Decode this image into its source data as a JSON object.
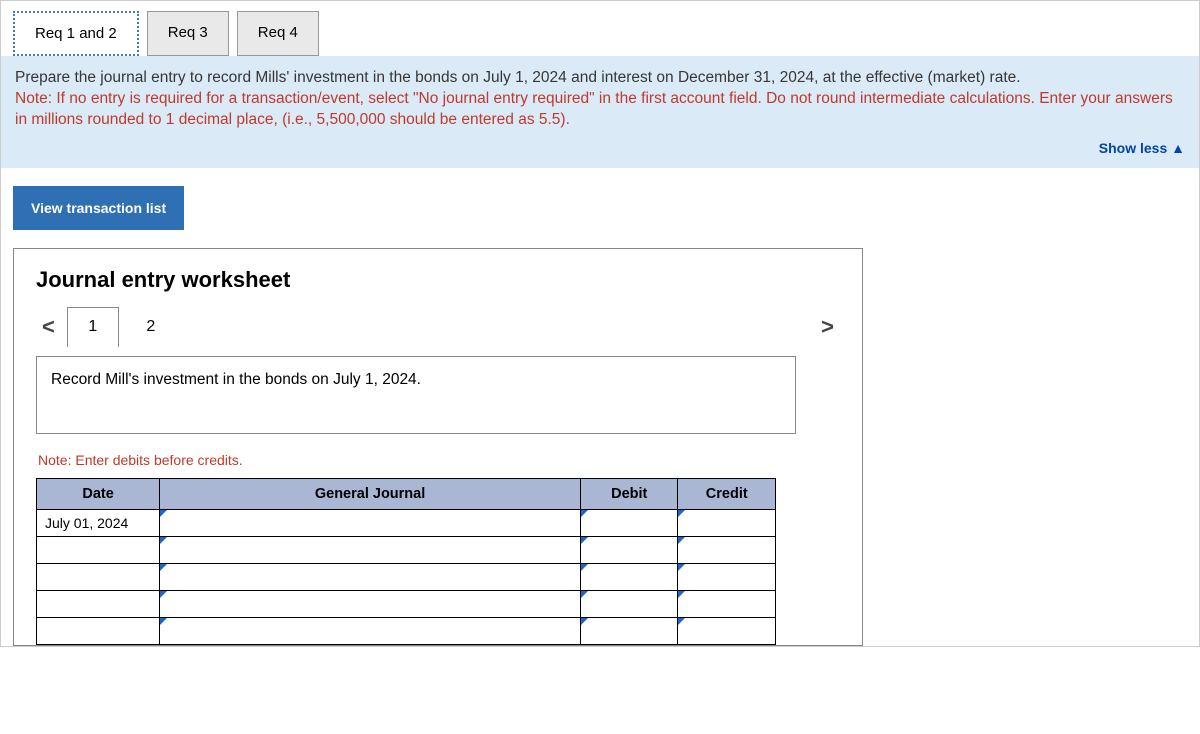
{
  "tabs": {
    "t1": "Req 1 and 2",
    "t2": "Req 3",
    "t3": "Req 4"
  },
  "instructions": {
    "main": "Prepare the journal entry to record Mills' investment in the bonds on July 1, 2024 and interest on December 31, 2024, at the effective (market) rate.",
    "note": "Note: If no entry is required for a transaction/event, select \"No journal entry required\" in the first account field. Do not round intermediate calculations. Enter your answers in millions rounded to 1 decimal place, (i.e., 5,500,000 should be entered as 5.5).",
    "show_less": "Show less"
  },
  "buttons": {
    "view_txn": "View transaction list"
  },
  "worksheet": {
    "title": "Journal entry worksheet",
    "pages": {
      "p1": "1",
      "p2": "2"
    },
    "entry_desc": "Record Mill's investment in the bonds on July 1, 2024.",
    "entry_note": "Note: Enter debits before credits.",
    "headers": {
      "date": "Date",
      "gj": "General Journal",
      "debit": "Debit",
      "credit": "Credit"
    },
    "rows": {
      "r1_date": "July 01, 2024"
    }
  }
}
